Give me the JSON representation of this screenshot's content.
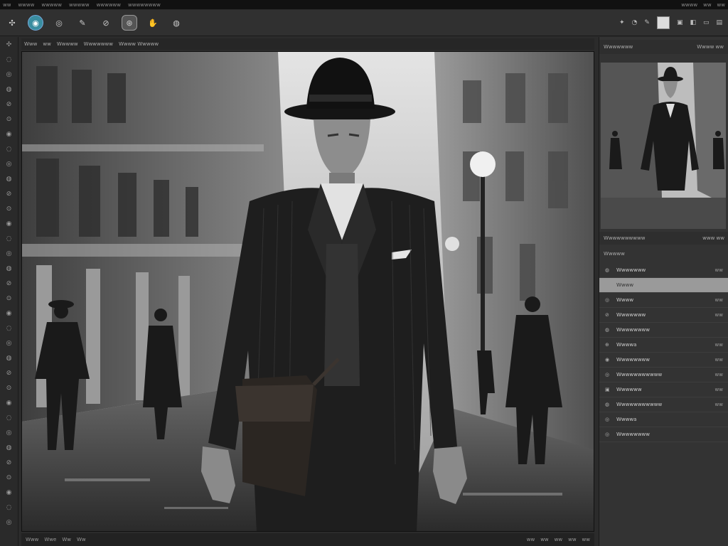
{
  "menubar": {
    "items": [
      "ww",
      "wwww",
      "wwwww",
      "wwwww",
      "wwwwww",
      "wwwwwwww"
    ],
    "right": [
      "wwww",
      "ww",
      "ww"
    ]
  },
  "toolbar": {
    "tools": [
      {
        "icon": "move-icon",
        "glyph": "✣"
      },
      {
        "icon": "brush-icon",
        "glyph": "◉",
        "state": "active"
      },
      {
        "icon": "eraser-icon",
        "glyph": "◎"
      },
      {
        "icon": "pen-icon",
        "glyph": "✎"
      },
      {
        "icon": "smudge-icon",
        "glyph": "⊘"
      },
      {
        "icon": "clone-icon",
        "glyph": "⊛",
        "state": "selected"
      },
      {
        "icon": "hand-icon",
        "glyph": "✋"
      },
      {
        "icon": "dodge-icon",
        "glyph": "◍"
      }
    ],
    "right_icons": [
      "✦",
      "◔",
      "✎",
      "▣",
      "◧",
      "▭",
      "▤"
    ],
    "swatch_color": "#dddddd"
  },
  "canvas_header": {
    "items": [
      "Www",
      "ww",
      "Wwwww",
      "Wwwwwww",
      "Wwww Wwwww"
    ]
  },
  "canvas_image": {
    "scene": "monochrome",
    "colors": {
      "sky": "#d8d8d8",
      "building": "#6a6a6a",
      "suit": "#1e1e1e",
      "shirt": "#e6e6e6"
    }
  },
  "statusbar": {
    "items": [
      "Www",
      "Wwe",
      "Ww",
      "Ww"
    ],
    "right": [
      "ww",
      "ww",
      "ww",
      "ww",
      "ww"
    ]
  },
  "navigator": {
    "title": "Wwwwwww",
    "title_right": "Wwww  ww",
    "foot_left": "Wwwwwwwwww",
    "foot_right": "www ww"
  },
  "layers": {
    "title": "Wwwww",
    "items": [
      {
        "icon": "◍",
        "label": "Wwwwwww",
        "value": "ww"
      },
      {
        "icon": "",
        "label": "Wwww",
        "value": "",
        "selected": true
      },
      {
        "icon": "◎",
        "label": "Wwww",
        "value": "ww"
      },
      {
        "icon": "⊘",
        "label": "Wwwwwww",
        "value": "ww"
      },
      {
        "icon": "◍",
        "label": "Wwwwwwww",
        "value": ""
      },
      {
        "icon": "⊕",
        "label": "Wwwwa",
        "value": "ww"
      },
      {
        "icon": "◉",
        "label": "Wwwwwwww",
        "value": "ww"
      },
      {
        "icon": "◎",
        "label": "Wwwwwwwwwww",
        "value": "ww"
      },
      {
        "icon": "▣",
        "label": "Wwwwww",
        "value": "ww"
      },
      {
        "icon": "◍",
        "label": "Wwwwwwwwwww",
        "value": "ww"
      },
      {
        "icon": "◎",
        "label": "Wwwwa",
        "value": ""
      },
      {
        "icon": "◎",
        "label": "Wwwwwwww",
        "value": ""
      }
    ]
  }
}
